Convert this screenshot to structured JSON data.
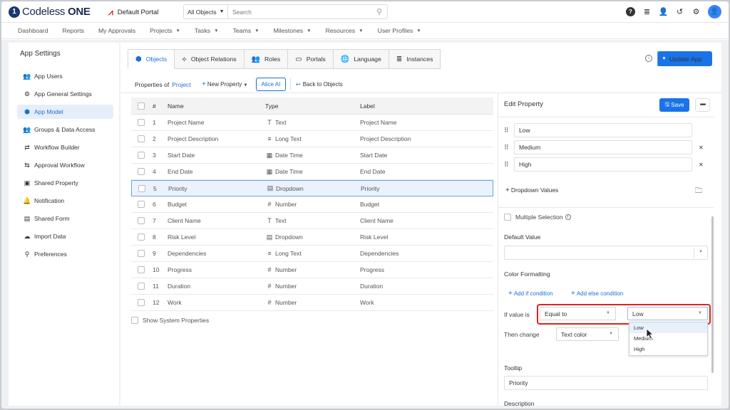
{
  "app": {
    "logo_mark": "1",
    "logo_name": "Codeless",
    "logo_name_bold": "ONE",
    "portal": "Default Portal"
  },
  "search": {
    "scope": "All Objects",
    "placeholder": "Search"
  },
  "nav": [
    "Dashboard",
    "Reports",
    "My Approvals",
    "Projects",
    "Tasks",
    "Teams",
    "Milestones",
    "Resources",
    "User Profiles"
  ],
  "nav_dropdown": [
    false,
    false,
    false,
    true,
    true,
    true,
    true,
    true,
    true
  ],
  "sidebar": {
    "title": "App Settings",
    "items": [
      {
        "label": "App Users",
        "icon": "users-icon"
      },
      {
        "label": "App General Settings",
        "icon": "gear-icon"
      },
      {
        "label": "App Model",
        "icon": "cube-icon",
        "active": true
      },
      {
        "label": "Groups & Data Access",
        "icon": "groups-icon"
      },
      {
        "label": "Workflow Builder",
        "icon": "workflow-icon"
      },
      {
        "label": "Approval Workflow",
        "icon": "approval-icon"
      },
      {
        "label": "Shared Property",
        "icon": "shared-property-icon"
      },
      {
        "label": "Notification",
        "icon": "bell-icon"
      },
      {
        "label": "Shared Form",
        "icon": "form-icon"
      },
      {
        "label": "Import Data",
        "icon": "cloud-upload-icon"
      },
      {
        "label": "Preferences",
        "icon": "preferences-icon"
      }
    ]
  },
  "tabs": [
    "Objects",
    "Object Relations",
    "Roles",
    "Portals",
    "Language",
    "Instances"
  ],
  "update_button": "Update App",
  "toolbar": {
    "properties_of": "Properties of",
    "object": "Project",
    "new_property": "New Property",
    "alice": "Alice AI",
    "back": "Back to Objects"
  },
  "grid": {
    "headers": [
      "#",
      "Name",
      "Type",
      "Label"
    ],
    "rows": [
      {
        "n": "1",
        "name": "Project Name",
        "type": "Text",
        "label": "Project Name"
      },
      {
        "n": "2",
        "name": "Project Description",
        "type": "Long Text",
        "label": "Project Description"
      },
      {
        "n": "3",
        "name": "Start Date",
        "type": "Date Time",
        "label": "Start Date"
      },
      {
        "n": "4",
        "name": "End Date",
        "type": "Date Time",
        "label": "End Date"
      },
      {
        "n": "5",
        "name": "Priority",
        "type": "Dropdown",
        "label": "Priority"
      },
      {
        "n": "6",
        "name": "Budget",
        "type": "Number",
        "label": "Budget"
      },
      {
        "n": "7",
        "name": "Client Name",
        "type": "Text",
        "label": "Client Name"
      },
      {
        "n": "8",
        "name": "Risk Level",
        "type": "Dropdown",
        "label": "Risk Level"
      },
      {
        "n": "9",
        "name": "Dependencies",
        "type": "Long Text",
        "label": "Dependencies"
      },
      {
        "n": "10",
        "name": "Progress",
        "type": "Number",
        "label": "Progress"
      },
      {
        "n": "11",
        "name": "Duration",
        "type": "Number",
        "label": "Duration"
      },
      {
        "n": "12",
        "name": "Work",
        "type": "Number",
        "label": "Work"
      }
    ],
    "show_system": "Show System Properties"
  },
  "edit": {
    "title": "Edit Property",
    "save": "Save",
    "values": [
      "Low",
      "Medium",
      "High"
    ],
    "add_values": "Dropdown Values",
    "multiple": "Multiple Selection",
    "default_value_label": "Default Value",
    "color_formatting": "Color Formatting",
    "add_if": "Add if condition",
    "add_else": "Add else condition",
    "if_value_is": "If value is",
    "operator": "Equal to",
    "value": "Low",
    "then_change": "Then change",
    "change_target": "Text color",
    "options": [
      "Low",
      "Medium",
      "High"
    ],
    "tooltip_label": "Tooltip",
    "tooltip_value": "Priority",
    "description_label": "Description"
  }
}
